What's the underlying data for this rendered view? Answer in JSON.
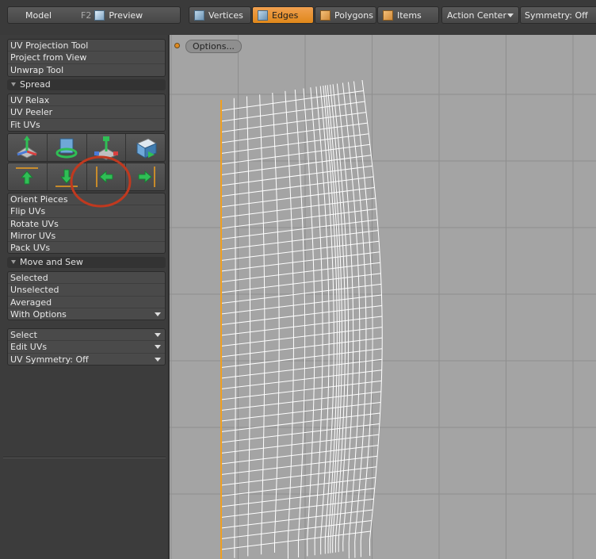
{
  "topbar": {
    "model_tab": "Model",
    "model_shortcut": "F2",
    "preview_tab": "Preview",
    "vertices": "Vertices",
    "edges": "Edges",
    "polygons": "Polygons",
    "items": "Items",
    "action_center": "Action Center",
    "symmetry": "Symmetry: Off"
  },
  "panel": {
    "tools": [
      "UV Projection Tool",
      "Project from View",
      "Unwrap Tool"
    ],
    "spread_header": "Spread",
    "spread_tools": [
      "UV Relax",
      "UV Peeler",
      "Fit UVs"
    ],
    "icon_row1": [
      "move-uv-icon",
      "rotate-uv-icon",
      "scale-uv-icon",
      "transform-uv-icon"
    ],
    "icon_row2": [
      "align-top-icon",
      "align-bottom-icon",
      "align-left-icon",
      "align-right-icon"
    ],
    "orient_tools": [
      "Orient Pieces",
      "Flip UVs",
      "Rotate UVs",
      "Mirror UVs",
      "Pack UVs"
    ],
    "move_sew_header": "Move and Sew",
    "move_sew_tools": [
      "Selected",
      "Unselected",
      "Averaged",
      "With Options"
    ],
    "dropdowns": [
      "Select",
      "Edit UVs",
      "UV Symmetry: Off"
    ]
  },
  "viewport": {
    "options_button": "Options..."
  },
  "colors": {
    "accent": "#f0a050",
    "highlight_circle": "#c0391f",
    "uv_edge": "#ffffff",
    "selected_edge": "#f0a020",
    "viewport_bg": "#a4a4a4"
  }
}
